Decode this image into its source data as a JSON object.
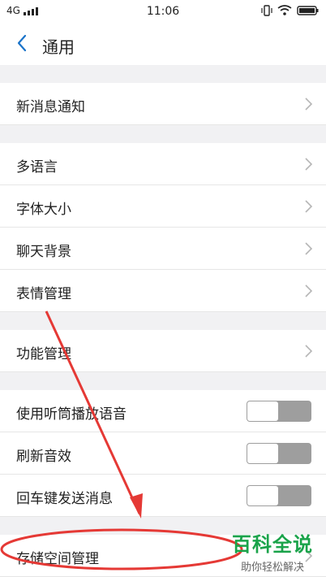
{
  "status_bar": {
    "network": "4G",
    "time": "11:06"
  },
  "header": {
    "title": "通用"
  },
  "sections": [
    {
      "items": [
        {
          "label": "新消息通知",
          "type": "nav"
        }
      ]
    },
    {
      "items": [
        {
          "label": "多语言",
          "type": "nav"
        },
        {
          "label": "字体大小",
          "type": "nav"
        },
        {
          "label": "聊天背景",
          "type": "nav"
        },
        {
          "label": "表情管理",
          "type": "nav"
        }
      ]
    },
    {
      "items": [
        {
          "label": "功能管理",
          "type": "nav"
        }
      ]
    },
    {
      "items": [
        {
          "label": "使用听筒播放语音",
          "type": "toggle",
          "on": false
        },
        {
          "label": "刷新音效",
          "type": "toggle",
          "on": false
        },
        {
          "label": "回车键发送消息",
          "type": "toggle",
          "on": false
        }
      ]
    },
    {
      "items": [
        {
          "label": "存储空间管理",
          "type": "nav"
        }
      ]
    }
  ],
  "watermark": {
    "title": "百科全说",
    "subtitle": "助你轻松解决"
  },
  "colors": {
    "accent": "#1a73c9",
    "annotation": "#e53935",
    "watermark": "#1aa34a"
  }
}
